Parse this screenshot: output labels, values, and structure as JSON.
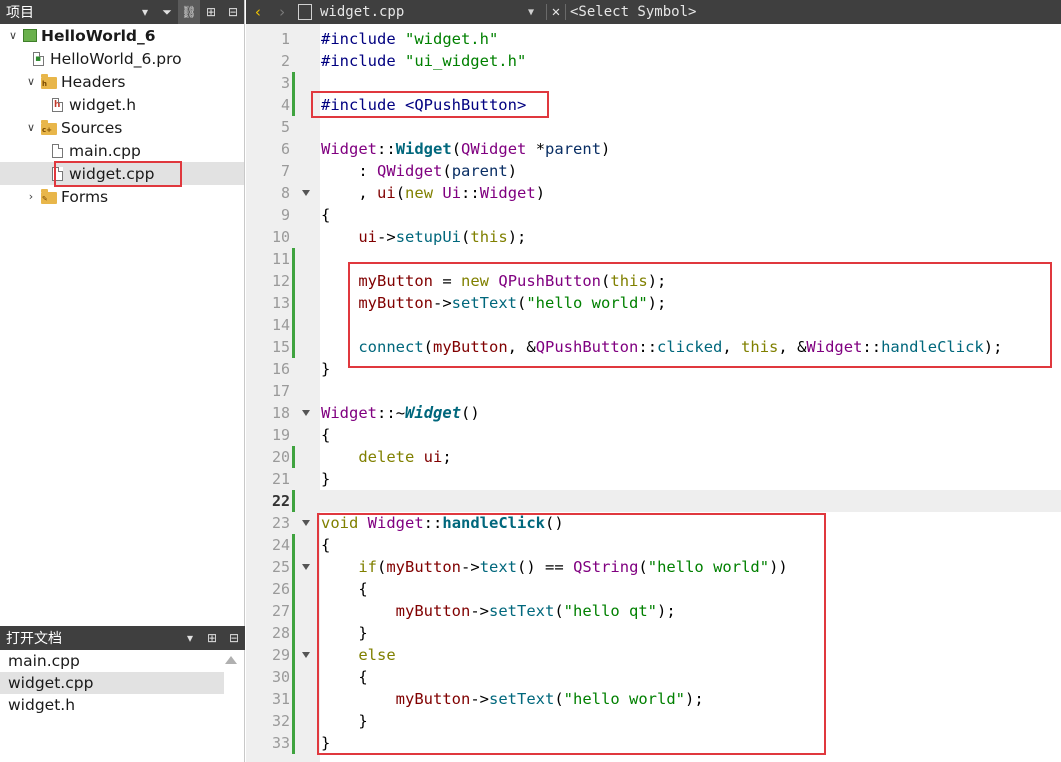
{
  "project_pane": {
    "title": "项目",
    "tree": [
      {
        "label": "HelloWorld_6",
        "depth": 0,
        "expanded": true,
        "icon": "qt-project-icon",
        "bold": true
      },
      {
        "label": "HelloWorld_6.pro",
        "depth": 1,
        "icon": "pro-file-icon"
      },
      {
        "label": "Headers",
        "depth": 1,
        "expanded": true,
        "icon": "headers-folder-icon"
      },
      {
        "label": "widget.h",
        "depth": 2,
        "icon": "header-file-icon"
      },
      {
        "label": "Sources",
        "depth": 1,
        "expanded": true,
        "icon": "sources-folder-icon"
      },
      {
        "label": "main.cpp",
        "depth": 2,
        "icon": "cpp-file-icon"
      },
      {
        "label": "widget.cpp",
        "depth": 2,
        "icon": "cpp-file-icon",
        "selected": true
      },
      {
        "label": "Forms",
        "depth": 1,
        "expanded": false,
        "icon": "forms-folder-icon"
      }
    ]
  },
  "open_documents": {
    "title": "打开文档",
    "items": [
      {
        "label": "main.cpp",
        "selected": false
      },
      {
        "label": "widget.cpp",
        "selected": true
      },
      {
        "label": "widget.h",
        "selected": false
      }
    ]
  },
  "editor": {
    "file_name": "widget.cpp",
    "symbol_selector": "<Select Symbol>",
    "current_line": 22,
    "line_numbers": [
      "1",
      "2",
      "3",
      "4",
      "5",
      "6",
      "7",
      "8",
      "9",
      "10",
      "11",
      "12",
      "13",
      "14",
      "15",
      "16",
      "17",
      "18",
      "19",
      "20",
      "21",
      "22",
      "23",
      "24",
      "25",
      "26",
      "27",
      "28",
      "29",
      "30",
      "31",
      "32",
      "33"
    ],
    "code": [
      "#include \"widget.h\"",
      "#include \"ui_widget.h\"",
      "",
      "#include <QPushButton>",
      "",
      "Widget::Widget(QWidget *parent)",
      "    : QWidget(parent)",
      "    , ui(new Ui::Widget)",
      "{",
      "    ui->setupUi(this);",
      "",
      "    myButton = new QPushButton(this);",
      "    myButton->setText(\"hello world\");",
      "",
      "    connect(myButton, &QPushButton::clicked, this, &Widget::handleClick);",
      "}",
      "",
      "Widget::~Widget()",
      "{",
      "    delete ui;",
      "}",
      "",
      "void Widget::handleClick()",
      "{",
      "    if(myButton->text() == QString(\"hello world\"))",
      "    {",
      "        myButton->setText(\"hello qt\");",
      "    }",
      "    else",
      "    {",
      "        myButton->setText(\"hello world\");",
      "    }",
      "}"
    ],
    "fold_lines": [
      8,
      18,
      23,
      25,
      29
    ],
    "modified_lines": [
      3,
      4,
      11,
      12,
      13,
      14,
      15,
      20,
      22,
      24,
      25,
      26,
      27,
      28,
      29,
      30,
      31,
      32,
      33
    ]
  },
  "colors": {
    "highlight_border": "#e0383e",
    "toolbar_bg": "#3f3f3f",
    "gutter_bg": "#efefef",
    "modified_marker": "#3fa33f"
  }
}
